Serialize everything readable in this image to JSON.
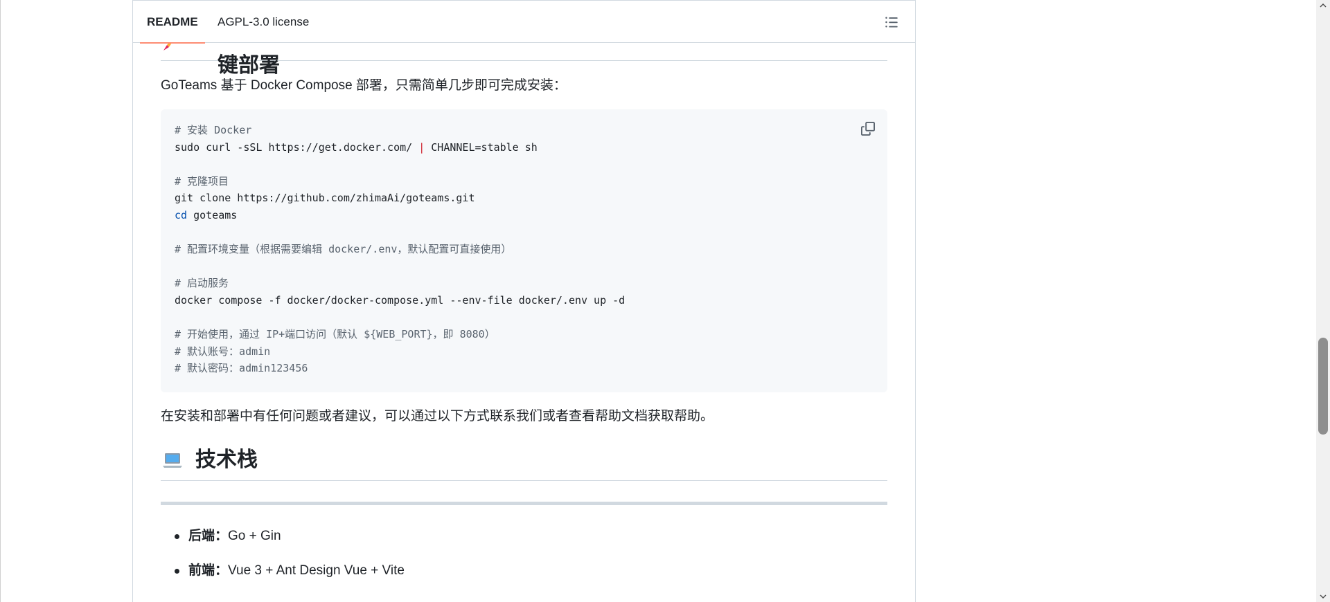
{
  "header": {
    "tabs": [
      {
        "label": "README",
        "active": true
      },
      {
        "label": "AGPL-3.0 license",
        "active": false
      }
    ],
    "outline_icon": "list-unordered-icon"
  },
  "deploy_section": {
    "heading_partial": "键部署",
    "heading_emoji": "rocket-icon",
    "intro": "GoTeams 基于 Docker Compose 部署，只需简单几步即可完成安装：",
    "code_lines": [
      {
        "segments": [
          {
            "t": "# 安装 Docker",
            "c": "comment"
          }
        ]
      },
      {
        "segments": [
          {
            "t": "sudo curl -sSL https://get.docker.com/ ",
            "c": ""
          },
          {
            "t": "|",
            "c": "op"
          },
          {
            "t": " CHANNEL=stable sh",
            "c": ""
          }
        ]
      },
      {
        "segments": [
          {
            "t": "",
            "c": ""
          }
        ]
      },
      {
        "segments": [
          {
            "t": "# 克隆项目",
            "c": "comment"
          }
        ]
      },
      {
        "segments": [
          {
            "t": "git clone https://github.com/zhimaAi/goteams.git",
            "c": ""
          }
        ]
      },
      {
        "segments": [
          {
            "t": "cd",
            "c": "kw"
          },
          {
            "t": " goteams",
            "c": ""
          }
        ]
      },
      {
        "segments": [
          {
            "t": "",
            "c": ""
          }
        ]
      },
      {
        "segments": [
          {
            "t": "# 配置环境变量（根据需要编辑 docker/.env，默认配置可直接使用）",
            "c": "comment"
          }
        ]
      },
      {
        "segments": [
          {
            "t": "",
            "c": ""
          }
        ]
      },
      {
        "segments": [
          {
            "t": "# 启动服务",
            "c": "comment"
          }
        ]
      },
      {
        "segments": [
          {
            "t": "docker compose -f docker/docker-compose.yml --env-file docker/.env up -d",
            "c": ""
          }
        ]
      },
      {
        "segments": [
          {
            "t": "",
            "c": ""
          }
        ]
      },
      {
        "segments": [
          {
            "t": "# 开始使用，通过 IP+端口访问（默认 ${WEB_PORT}，即 8080）",
            "c": "comment"
          }
        ]
      },
      {
        "segments": [
          {
            "t": "# 默认账号：admin",
            "c": "comment"
          }
        ]
      },
      {
        "segments": [
          {
            "t": "# 默认密码：admin123456",
            "c": "comment"
          }
        ]
      }
    ],
    "copy_icon": "copy-icon",
    "after_code": "在安装和部署中有任何问题或者建议，可以通过以下方式联系我们或者查看帮助文档获取帮助。"
  },
  "tech_section": {
    "heading": "技术栈",
    "heading_emoji": "laptop-icon",
    "items": [
      {
        "label": "后端",
        "sep": "：",
        "value": "Go + Gin"
      },
      {
        "label": "前端",
        "sep": "：",
        "value": "Vue 3 + Ant Design Vue + Vite"
      }
    ]
  },
  "colors": {
    "active_tab_underline": "#fd8c73",
    "code_bg": "#f6f8fa",
    "border": "#d1d9e0",
    "comment": "#59636e",
    "operator": "#cf222e",
    "keyword": "#0550ae"
  }
}
